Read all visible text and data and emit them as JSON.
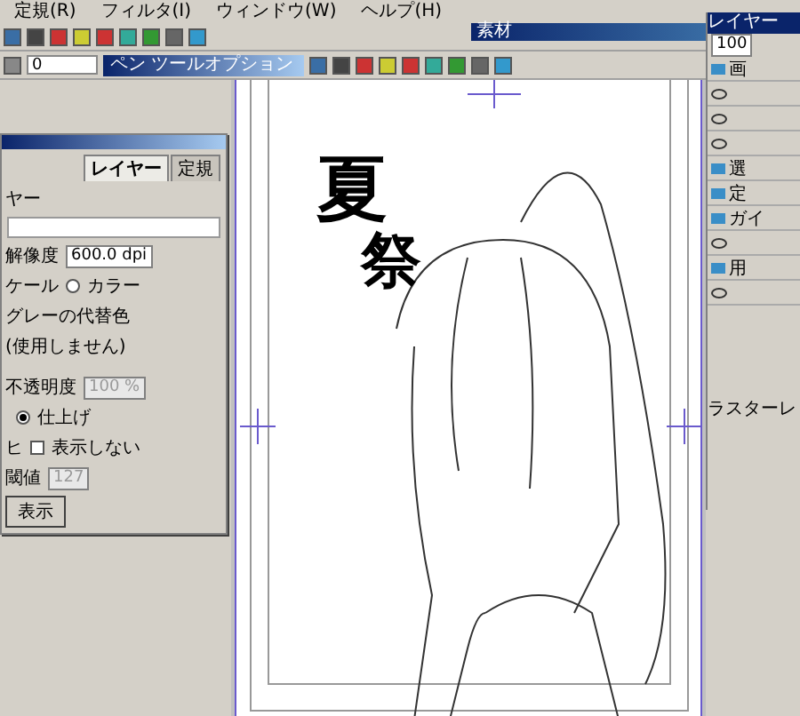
{
  "menu": [
    "定規(R)",
    "フィルタ(I)",
    "ウィンドウ(W)",
    "ヘルプ(H)"
  ],
  "toolbar": {
    "value": "0"
  },
  "pen_tool_options": {
    "title": "ペン ツールオプション"
  },
  "material_panel": {
    "title": "素材"
  },
  "canvas": {
    "title_chars": [
      "夏",
      "祭"
    ]
  },
  "properties_panel": {
    "tabs": [
      {
        "label": "レイヤー",
        "selected": true
      },
      {
        "label": "定規",
        "selected": false
      }
    ],
    "section": "ヤー",
    "resolution_label": "解像度",
    "resolution": "600.0 dpi",
    "scale_label": "ケール",
    "color_radio": {
      "label": "カラー",
      "selected": false
    },
    "gray_substitute": "グレーの代替色",
    "substitute_value": "(使用しません)",
    "opacity_label": "不透明度",
    "opacity": "100 %",
    "output_radio": {
      "label": "仕上げ",
      "selected": true
    },
    "prefix_label": "ヒ",
    "hide_checkbox": {
      "label": "表示しない",
      "checked": false
    },
    "threshold_label": "閾値",
    "threshold": "127",
    "show_button": "表示"
  },
  "layers_panel": {
    "title": "レイヤー",
    "zoom": "100",
    "footer": "ラスターレ",
    "rows": [
      {
        "kind": "folder",
        "name": "画"
      },
      {
        "kind": "layer"
      },
      {
        "kind": "layer"
      },
      {
        "kind": "layer"
      },
      {
        "kind": "folder",
        "name": "選"
      },
      {
        "kind": "folder",
        "name": "定"
      },
      {
        "kind": "folder",
        "name": "ガイ"
      },
      {
        "kind": "layer"
      },
      {
        "kind": "folder",
        "name": "用"
      },
      {
        "kind": "layer"
      }
    ]
  }
}
